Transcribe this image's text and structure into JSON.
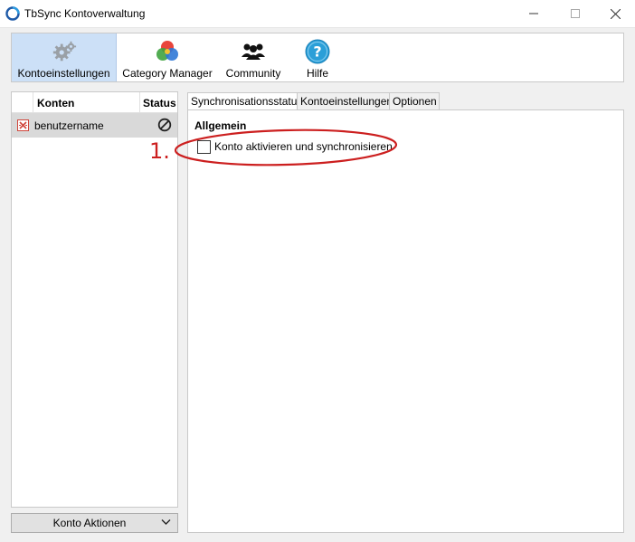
{
  "window": {
    "title": "TbSync Kontoverwaltung"
  },
  "toolbar": {
    "items": [
      {
        "label": "Kontoeinstellungen",
        "icon": "gears-icon",
        "selected": true
      },
      {
        "label": "Category Manager",
        "icon": "color-circles-icon"
      },
      {
        "label": "Community",
        "icon": "people-icon"
      },
      {
        "label": "Hilfe",
        "icon": "help-icon"
      }
    ]
  },
  "accounts": {
    "headers": {
      "name": "Konten",
      "status": "Status"
    },
    "rows": [
      {
        "name": "benutzername",
        "icon": "account-sync-icon",
        "status_icon": "disabled-icon"
      }
    ],
    "actions_label": "Konto Aktionen"
  },
  "tabs": [
    {
      "label": "Synchronisationsstatus",
      "active": true
    },
    {
      "label": "Kontoeinstellungen"
    },
    {
      "label": "Optionen"
    }
  ],
  "content": {
    "group_title": "Allgemein",
    "checkbox_label": "Konto aktivieren und synchronisieren",
    "checked": false
  },
  "annotation": {
    "label": "1.",
    "color": "#cc1f1f"
  },
  "colors": {
    "accent": "#cce0f7",
    "help_icon": "#2b9fd8",
    "annotation": "#cc1f1f"
  }
}
